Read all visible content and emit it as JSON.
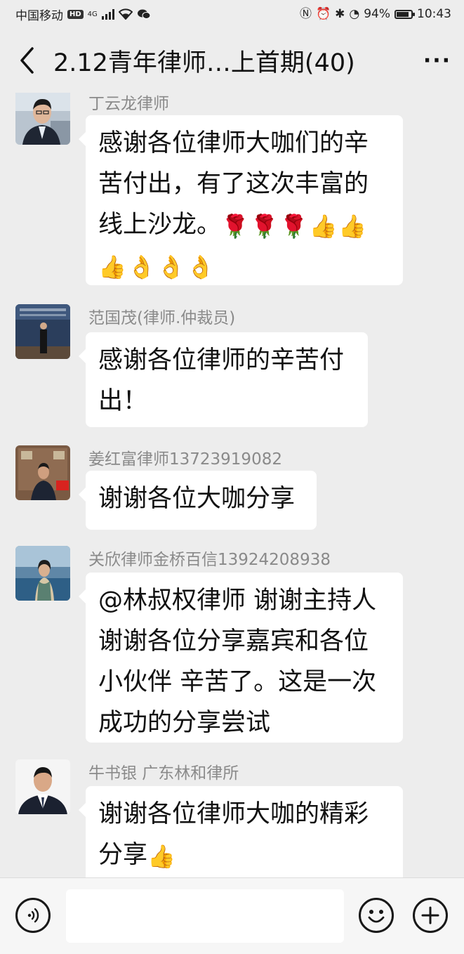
{
  "status_bar": {
    "carrier": "中国移动",
    "hd": "HD",
    "network": "4G",
    "battery": "94%",
    "battery_level": 0.94,
    "time": "10:43",
    "icons": [
      "nfc-icon",
      "alarm-icon",
      "bluetooth-icon",
      "data-saver-icon"
    ]
  },
  "header": {
    "title": "2.12青年律师…上首期(40)"
  },
  "messages": [
    {
      "sender": "丁云龙律师",
      "text": "感谢各位律师大咖们的辛苦付出，有了这次丰富的线上沙龙。",
      "emoji": [
        "🌹",
        "🌹",
        "🌹",
        "👍",
        "👍",
        "👍",
        "👌",
        "👌",
        "👌"
      ]
    },
    {
      "sender": "范国茂(律师.仲裁员)",
      "text": "感谢各位律师的辛苦付出！"
    },
    {
      "sender": "姜红富律师13723919082",
      "text": "谢谢各位大咖分享"
    },
    {
      "sender": "关欣律师金桥百信13924208938",
      "text": "@林叔权律师  谢谢主持人谢谢各位分享嘉宾和各位小伙伴 辛苦了。这是一次成功的分享尝试"
    },
    {
      "sender": "牛书银 广东林和律所",
      "text": "谢谢各位律师大咖的精彩分享",
      "emoji": [
        "👍"
      ]
    }
  ],
  "input_bar": {
    "placeholder": ""
  }
}
